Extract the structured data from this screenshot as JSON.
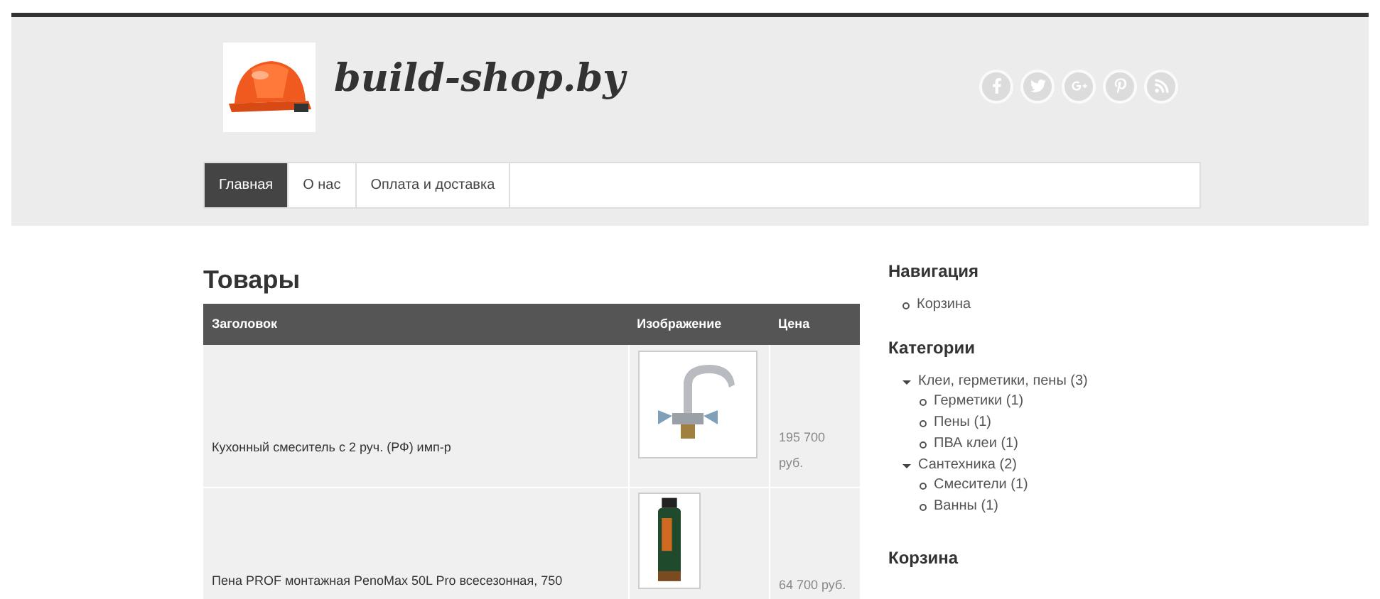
{
  "site": {
    "title": "build-shop.by"
  },
  "menu": [
    {
      "label": "Главная",
      "selected": true
    },
    {
      "label": "О нас",
      "selected": false
    },
    {
      "label": "Оплата и доставка",
      "selected": false
    }
  ],
  "content": {
    "heading": "Товары",
    "table": {
      "columns": [
        "Заголовок",
        "Изображение",
        "Цена"
      ],
      "rows": [
        {
          "title": "Кухонный смеситель с 2 руч. (РФ) имп-р",
          "image": {
            "kind": "faucet"
          },
          "price": "195 700 руб."
        },
        {
          "title": "Пена PROF монтажная PenoMax 50L Pro всесезонная, 750",
          "image": {
            "kind": "can"
          },
          "price": "64 700 руб."
        }
      ]
    }
  },
  "sidebar": {
    "navigation": {
      "heading": "Навигация",
      "items": [
        "Корзина"
      ]
    },
    "categories": {
      "heading": "Категории",
      "items": [
        {
          "label": "Клеи, герметики, пены (3)",
          "expanded": true,
          "children": [
            {
              "label": "Герметики (1)"
            },
            {
              "label": "Пены (1)"
            },
            {
              "label": "ПВА клеи (1)"
            }
          ]
        },
        {
          "label": "Сантехника (2)",
          "expanded": true,
          "children": [
            {
              "label": "Смесители (1)"
            },
            {
              "label": "Ванны (1)"
            }
          ]
        }
      ]
    },
    "cart": {
      "heading": "Корзина"
    }
  }
}
